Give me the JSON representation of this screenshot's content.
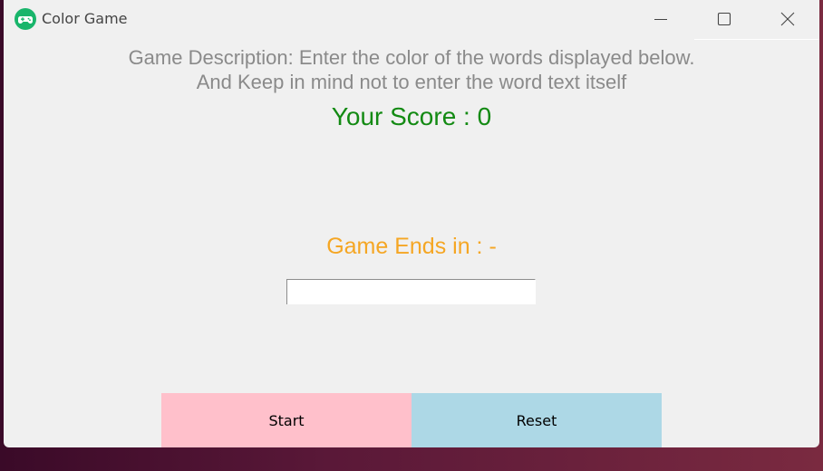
{
  "window": {
    "title": "Color Game",
    "icon": "gamepad-icon",
    "controls": [
      "minimize-icon",
      "maximize-icon",
      "close-icon"
    ]
  },
  "game": {
    "description_line1": "Game Description: Enter the color of the words displayed below.",
    "description_line2": "And Keep in mind not to enter the word text itself",
    "score_text": "Your Score : 0",
    "timer_text": "Game Ends in : -",
    "entry_value": ""
  },
  "buttons": {
    "start_label": "Start",
    "reset_label": "Reset"
  },
  "colors": {
    "score": "#138a13",
    "timer": "#f5a623",
    "description": "#8a8a8a",
    "start_button": "#ffc0cb",
    "reset_button": "#add8e6",
    "window_bg": "#f0f0f0"
  }
}
